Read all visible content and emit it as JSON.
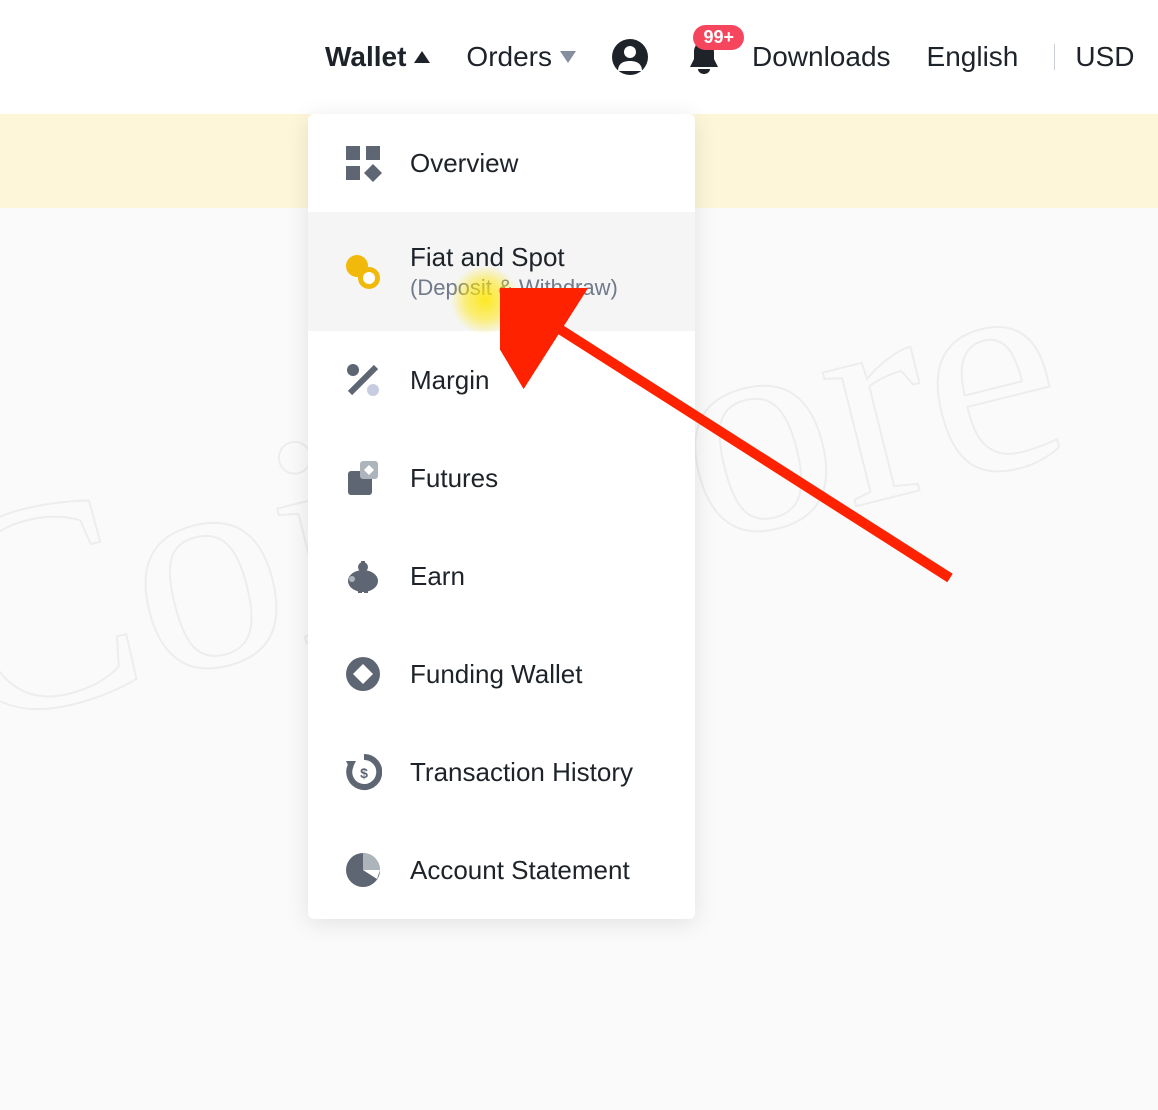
{
  "nav": {
    "wallet": "Wallet",
    "orders": "Orders",
    "downloads": "Downloads",
    "language": "English",
    "currency": "USD",
    "badge": "99+"
  },
  "menu": {
    "items": [
      {
        "label": "Overview",
        "sub": "",
        "icon": "grid"
      },
      {
        "label": "Fiat and Spot",
        "sub": "(Deposit & Withdraw)",
        "icon": "swap"
      },
      {
        "label": "Margin",
        "sub": "",
        "icon": "percent"
      },
      {
        "label": "Futures",
        "sub": "",
        "icon": "futures"
      },
      {
        "label": "Earn",
        "sub": "",
        "icon": "earn"
      },
      {
        "label": "Funding Wallet",
        "sub": "",
        "icon": "funding"
      },
      {
        "label": "Transaction History",
        "sub": "",
        "icon": "history"
      },
      {
        "label": "Account Statement",
        "sub": "",
        "icon": "statement"
      }
    ]
  }
}
